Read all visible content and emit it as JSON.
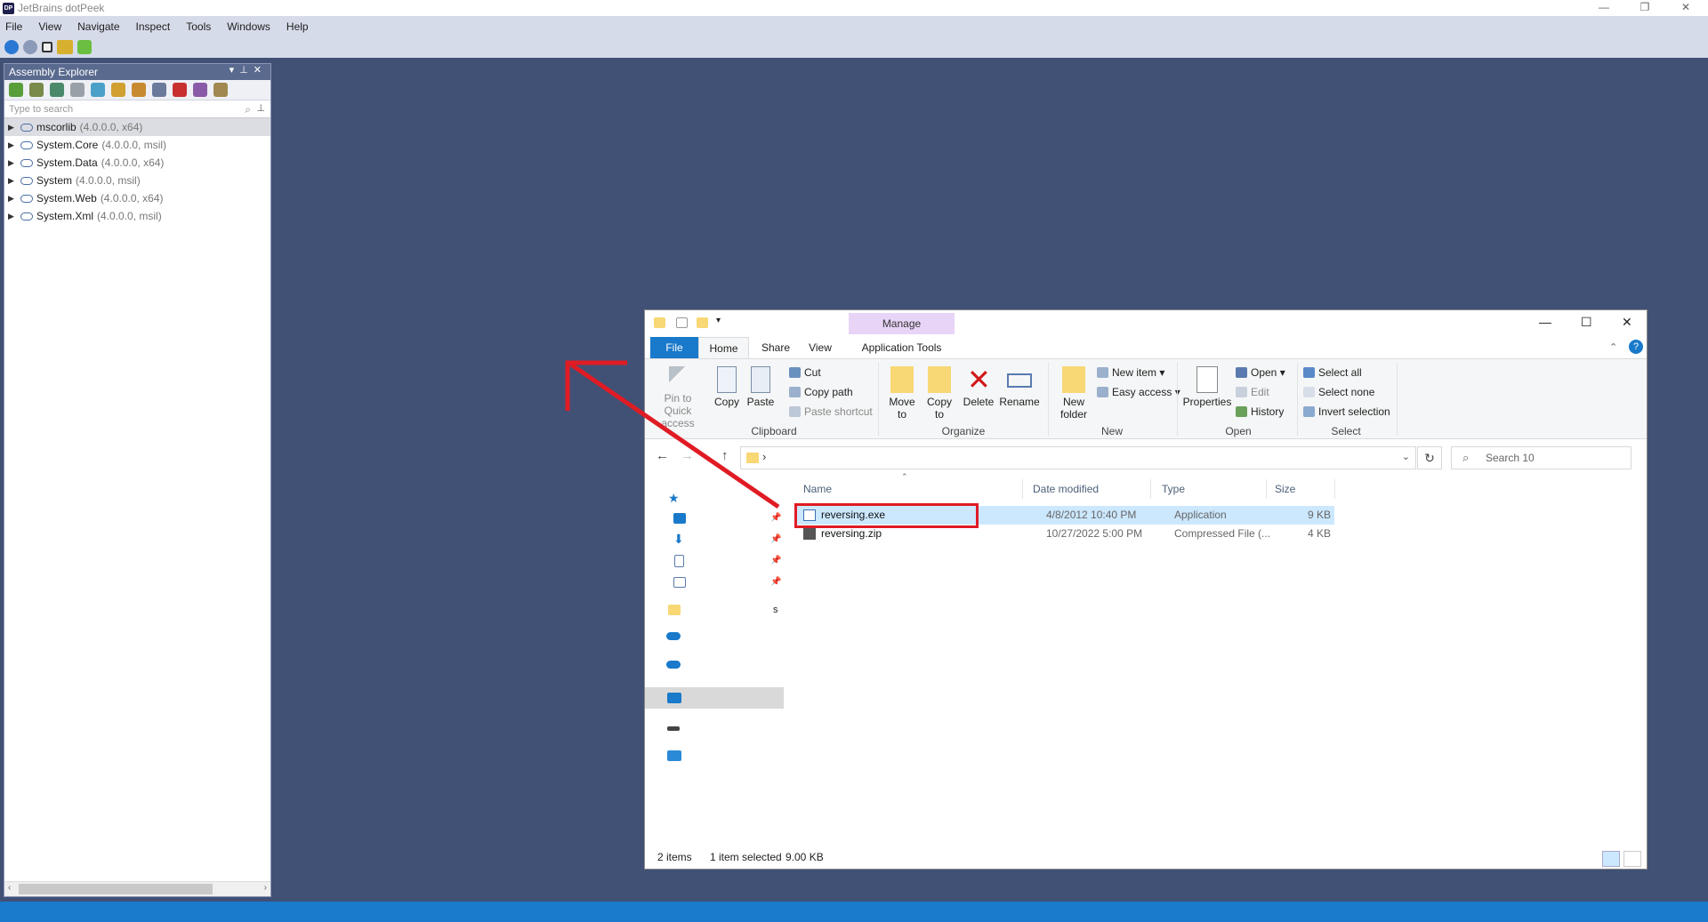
{
  "app": {
    "title": "JetBrains dotPeek",
    "menu": [
      "File",
      "View",
      "Navigate",
      "Inspect",
      "Tools",
      "Windows",
      "Help"
    ]
  },
  "assembly_explorer": {
    "title": "Assembly Explorer",
    "search_placeholder": "Type to search",
    "assemblies": [
      {
        "name": "mscorlib",
        "version": "(4.0.0.0, x64)",
        "selected": true
      },
      {
        "name": "System.Core",
        "version": "(4.0.0.0, msil)"
      },
      {
        "name": "System.Data",
        "version": "(4.0.0.0, x64)"
      },
      {
        "name": "System",
        "version": "(4.0.0.0, msil)"
      },
      {
        "name": "System.Web",
        "version": "(4.0.0.0, x64)"
      },
      {
        "name": "System.Xml",
        "version": "(4.0.0.0, msil)"
      }
    ]
  },
  "explorer": {
    "contextual_tab": "Manage",
    "tabs": {
      "file": "File",
      "home": "Home",
      "share": "Share",
      "view": "View",
      "app_tools": "Application Tools"
    },
    "clipboard": {
      "pin": "Pin to Quick access",
      "copy": "Copy",
      "paste": "Paste",
      "cut": "Cut",
      "copy_path": "Copy path",
      "paste_shortcut": "Paste shortcut",
      "group": "Clipboard"
    },
    "organize": {
      "move_to": "Move to",
      "copy_to": "Copy to",
      "delete": "Delete",
      "rename": "Rename",
      "group": "Organize"
    },
    "new": {
      "new_folder": "New folder",
      "new_item": "New item",
      "easy_access": "Easy access",
      "group": "New"
    },
    "open": {
      "properties": "Properties",
      "open": "Open",
      "edit": "Edit",
      "history": "History",
      "group": "Open"
    },
    "select": {
      "select_all": "Select all",
      "select_none": "Select none",
      "invert": "Invert selection",
      "group": "Select"
    },
    "search_placeholder": "Search 10",
    "columns": {
      "name": "Name",
      "date": "Date modified",
      "type": "Type",
      "size": "Size"
    },
    "files": [
      {
        "name": "reversing.exe",
        "date": "4/8/2012 10:40 PM",
        "type": "Application",
        "size": "9 KB",
        "selected": true
      },
      {
        "name": "reversing.zip",
        "date": "10/27/2022 5:00 PM",
        "type": "Compressed File (...",
        "size": "4 KB"
      }
    ],
    "nav_label_partial": "s",
    "status": {
      "items": "2 items",
      "selected": "1 item selected",
      "size": "9.00 KB"
    }
  },
  "colors": {
    "desktop": "#415175",
    "accent": "#1979ca",
    "annotation": "#e01b24",
    "manage_tab": "#e8d4f7"
  }
}
